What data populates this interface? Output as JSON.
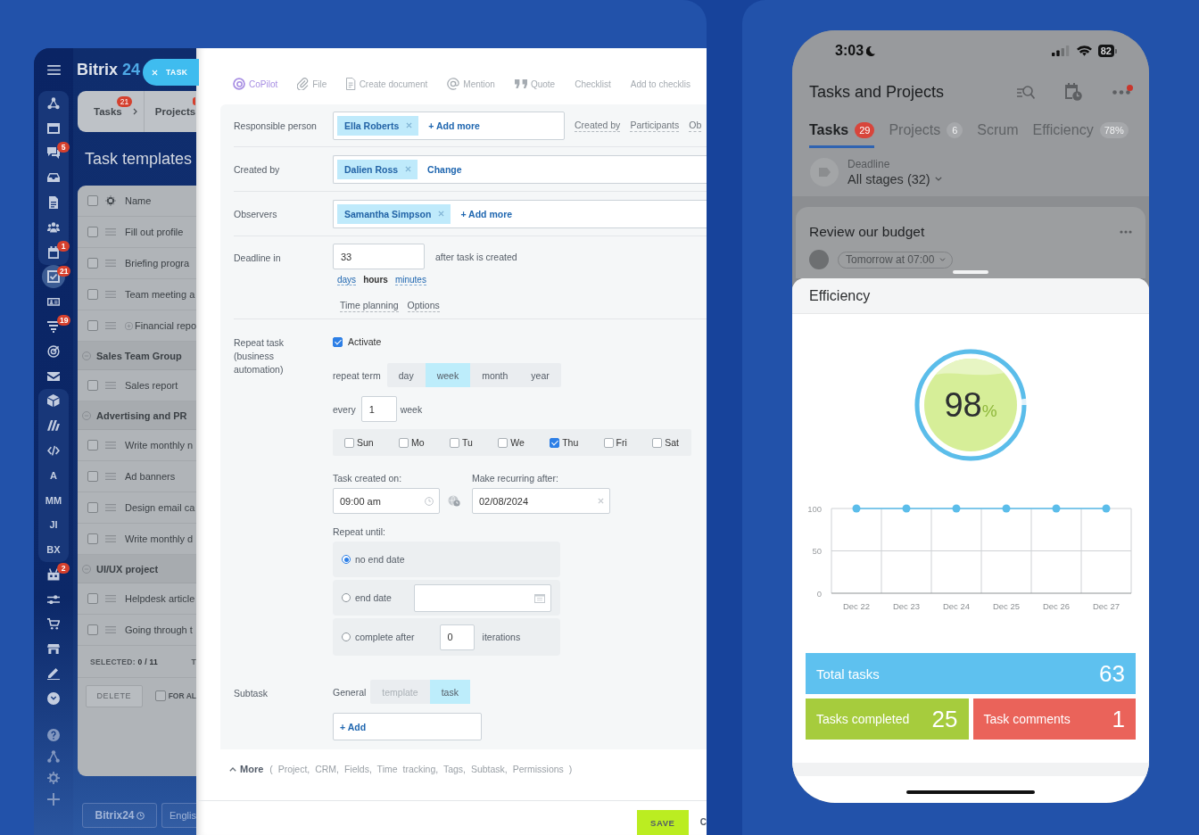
{
  "workspace": {
    "sidebar": {
      "sections": [
        {
          "grouped": true,
          "items": [
            {
              "kind": "icon",
              "selected": false
            },
            {
              "kind": "icon",
              "selected": false
            },
            {
              "kind": "icon",
              "selected": false,
              "badge": "5"
            },
            {
              "kind": "icon",
              "selected": false
            },
            {
              "kind": "icon",
              "selected": false
            },
            {
              "kind": "icon",
              "selected": false
            },
            {
              "kind": "icon",
              "selected": false,
              "badge": "1"
            }
          ]
        },
        {
          "grouped": false,
          "items": [
            {
              "kind": "icon",
              "selected": true,
              "badge": "21"
            },
            {
              "kind": "icon",
              "selected": false
            },
            {
              "kind": "icon",
              "selected": false,
              "badge": "19"
            },
            {
              "kind": "icon",
              "selected": false
            },
            {
              "kind": "icon",
              "selected": false
            }
          ]
        },
        {
          "grouped": true,
          "items": [
            {
              "kind": "icon",
              "selected": false
            },
            {
              "kind": "icon",
              "selected": false
            },
            {
              "kind": "icon",
              "selected": false
            },
            {
              "kind": "text",
              "label": "A",
              "selected": false
            },
            {
              "kind": "text",
              "label": "MM",
              "selected": false
            },
            {
              "kind": "text",
              "label": "JI",
              "selected": false
            },
            {
              "kind": "text",
              "label": "BX",
              "selected": false
            }
          ]
        },
        {
          "grouped": false,
          "items": [
            {
              "kind": "icon",
              "selected": false,
              "badge": "2"
            },
            {
              "kind": "icon",
              "selected": false
            },
            {
              "kind": "icon",
              "selected": false
            },
            {
              "kind": "icon",
              "selected": false
            },
            {
              "kind": "icon",
              "selected": false
            },
            {
              "kind": "icon",
              "selected": false
            }
          ]
        },
        {
          "grouped": false,
          "items": [
            {
              "kind": "icon",
              "selected": false
            },
            {
              "kind": "icon",
              "selected": false
            },
            {
              "kind": "icon",
              "selected": false
            },
            {
              "kind": "icon",
              "selected": false
            }
          ]
        }
      ]
    },
    "logo": {
      "text": "Bitrix",
      "accent": "24"
    },
    "tabs": [
      {
        "label": "Tasks",
        "badge": "21",
        "dropdown": true,
        "notification": false
      },
      {
        "label": "Projects",
        "dropdown": false,
        "notification": true
      }
    ],
    "page_title": "Task templates",
    "templates": {
      "column": "Name",
      "select_all_checked": false,
      "items": [
        {
          "kind": "task",
          "title": "Fill out profile",
          "checked": false
        },
        {
          "kind": "task",
          "title": "Briefing progra",
          "checked": false
        },
        {
          "kind": "task",
          "title": "Team meeting a",
          "checked": false
        },
        {
          "kind": "parent",
          "title": "Financial repo",
          "checked": false,
          "expanded": false
        }
      ],
      "groups": [
        {
          "title": "Sales Team Group",
          "expanded": true,
          "children": [
            {
              "kind": "task",
              "title": "Sales report",
              "checked": false
            }
          ]
        },
        {
          "title": "Advertising and PR",
          "expanded": true,
          "children": [
            {
              "kind": "task",
              "title": "Write monthly n",
              "checked": false
            },
            {
              "kind": "task",
              "title": "Ad banners",
              "checked": false
            },
            {
              "kind": "task",
              "title": "Design email ca",
              "checked": false
            },
            {
              "kind": "task",
              "title": "Write monthly d",
              "checked": false
            }
          ]
        },
        {
          "title": "UI/UX project",
          "expanded": true,
          "children": [
            {
              "kind": "task",
              "title": "Helpdesk article",
              "checked": false
            },
            {
              "kind": "task",
              "title": "Going through t",
              "checked": false
            }
          ]
        }
      ],
      "summary": "SELECTED: **0 / 11**",
      "summary_cut": "T",
      "delete_button": {
        "label": "DELETE",
        "disabled": true
      },
      "apply_all": {
        "label": "FOR AL",
        "checked": false
      }
    },
    "footer_buttons": [
      {
        "kind": "logo",
        "label": "Bitrix24"
      },
      {
        "kind": "language",
        "label": "Englis"
      }
    ],
    "task_slider": {
      "tab": "TASK",
      "toolbar": [
        {
          "label": "CoPilot",
          "kind": "ai"
        },
        {
          "label": "File",
          "kind": "tool"
        },
        {
          "label": "Create document",
          "kind": "tool"
        },
        {
          "label": "Mention",
          "kind": "tool"
        },
        {
          "label": "Quote",
          "kind": "tool"
        },
        {
          "label": "Checklist",
          "kind": "text"
        },
        {
          "label": "Add to checklis",
          "kind": "text"
        }
      ],
      "people": [
        {
          "label": "Responsible person",
          "chips": [
            "Ella Roberts"
          ],
          "action": "+ Add more",
          "links": [
            "Created by",
            "Participants",
            "Ob"
          ]
        },
        {
          "label": "Created by",
          "chips": [
            "Dalien Ross"
          ],
          "action": "Change"
        },
        {
          "label": "Observers",
          "chips": [
            "Samantha Simpson"
          ],
          "action": "+ Add more"
        }
      ],
      "deadline": {
        "label": "Deadline in",
        "value": "33",
        "suffix": "after task is created",
        "units": [
          {
            "label": "days",
            "selected": false
          },
          {
            "label": "hours",
            "selected": true
          },
          {
            "label": "minutes",
            "selected": false
          }
        ],
        "links": [
          "Time planning",
          "Options"
        ]
      },
      "repeat": {
        "label": "Repeat task (business automation)",
        "activate": {
          "label": "Activate",
          "checked": true
        },
        "term_label": "repeat term",
        "terms": [
          {
            "label": "day",
            "selected": false
          },
          {
            "label": "week",
            "selected": true
          },
          {
            "label": "month",
            "selected": false
          },
          {
            "label": "year",
            "selected": false
          }
        ],
        "every_label": "every",
        "every_value": "1",
        "every_unit": "week",
        "days": [
          {
            "label": "Sun",
            "checked": false
          },
          {
            "label": "Mo",
            "checked": false
          },
          {
            "label": "Tu",
            "checked": false
          },
          {
            "label": "We",
            "checked": false
          },
          {
            "label": "Thu",
            "checked": true
          },
          {
            "label": "Fri",
            "checked": false
          },
          {
            "label": "Sat",
            "checked": false
          }
        ],
        "start_label": "Task created on:",
        "start_time": "09:00 am",
        "after_label": "Make recurring after:",
        "after_date": "02/08/2024",
        "until_label": "Repeat until:",
        "until": [
          {
            "kind": "never",
            "label": "no end date",
            "selected": true
          },
          {
            "kind": "date",
            "label": "end date",
            "selected": false
          },
          {
            "kind": "count",
            "label": "complete after",
            "selected": false,
            "value": "0",
            "suffix": "iterations"
          }
        ]
      },
      "subtask": {
        "label": "Subtask",
        "scope": "General",
        "options": [
          {
            "label": "template",
            "selected": false,
            "disabled": true
          },
          {
            "label": "task",
            "selected": true,
            "disabled": false
          }
        ],
        "add": "+ Add"
      },
      "more": {
        "label": "More",
        "fields": "( Project, CRM, Fields, Time tracking, Tags, Subtask, Permissions )"
      },
      "actions": {
        "save": "SAVE",
        "cancel": "C"
      }
    }
  },
  "phone": {
    "status_bar": {
      "time": "3:03",
      "battery": "82"
    },
    "title": "Tasks and Projects",
    "menu_notification": true,
    "tabs": [
      {
        "label": "Tasks",
        "badge": "29",
        "color": "#d8453b",
        "selected": true
      },
      {
        "label": "Projects",
        "badge": "6",
        "color": "#a6a8ab",
        "selected": false
      },
      {
        "label": "Scrum",
        "selected": false
      },
      {
        "label": "Efficiency",
        "badge": "78%",
        "color": "#a6a8ab",
        "selected": false
      }
    ],
    "filter": {
      "label": "Deadline",
      "value": "All stages (32)"
    },
    "task_card": {
      "title": "Review our budget",
      "deadline": "Tomorrow at 07:00"
    },
    "sheet": {
      "title": "Efficiency",
      "gauge": {
        "value": "98",
        "unit": "%",
        "level": 0.98
      },
      "chart_data": {
        "type": "line",
        "categories": [
          "Dec 22",
          "Dec 23",
          "Dec 24",
          "Dec 25",
          "Dec 26",
          "Dec 27"
        ],
        "series": [
          {
            "color": "#5bbdea",
            "marker": true,
            "values": [
              100,
              100,
              100,
              100,
              100,
              100
            ]
          }
        ],
        "ylim": [
          0,
          100
        ],
        "yticks": [
          0,
          50,
          100
        ]
      },
      "stats": [
        {
          "label": "Total tasks",
          "value": "63",
          "color": "#5ec1ef"
        },
        {
          "label": "Tasks completed",
          "value": "25",
          "color": "#a6cc3d"
        },
        {
          "label": "Task comments",
          "value": "1",
          "color": "#ea635a"
        }
      ]
    }
  }
}
